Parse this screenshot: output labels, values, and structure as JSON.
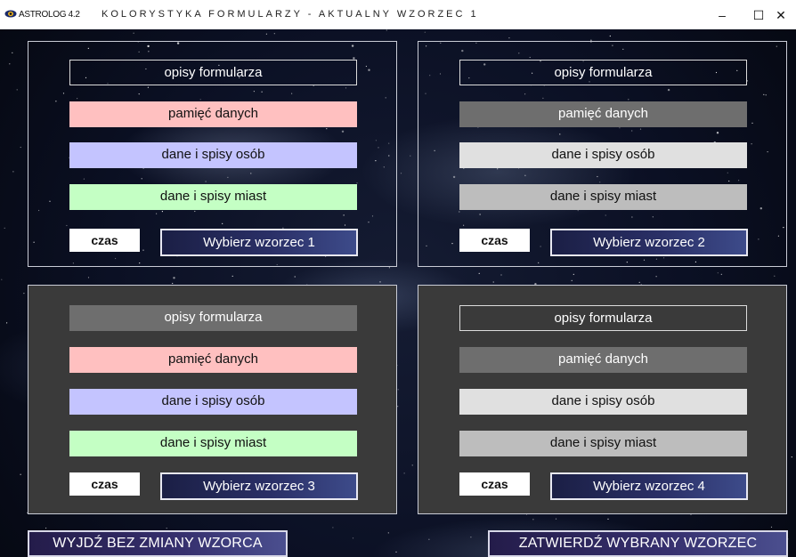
{
  "window": {
    "app_name": "ASTROLOG 4.2",
    "title": "KOLORYSTYKA FORMULARZY - AKTUALNY WZORZEC 1",
    "minimize": "–",
    "maximize": "☐",
    "close": "✕"
  },
  "panels": [
    {
      "bars": [
        {
          "label": "opisy formularza",
          "bg": "transparent",
          "fg": "#ffffff",
          "border": "#dcdcdc"
        },
        {
          "label": "pamięć danych",
          "bg": "#ffc0c0",
          "fg": "#111111",
          "border": "transparent"
        },
        {
          "label": "dane i spisy osób",
          "bg": "#c4c4ff",
          "fg": "#111111",
          "border": "transparent"
        },
        {
          "label": "dane i spisy miast",
          "bg": "#c4ffc4",
          "fg": "#111111",
          "border": "transparent"
        }
      ],
      "czas": "czas",
      "button": "Wybierz wzorzec 1"
    },
    {
      "bars": [
        {
          "label": "opisy formularza",
          "bg": "transparent",
          "fg": "#ffffff",
          "border": "#dcdcdc"
        },
        {
          "label": "pamięć danych",
          "bg": "#6e6e6e",
          "fg": "#ffffff",
          "border": "transparent"
        },
        {
          "label": "dane i spisy osób",
          "bg": "#e0e0e0",
          "fg": "#111111",
          "border": "transparent"
        },
        {
          "label": "dane i spisy miast",
          "bg": "#bdbdbd",
          "fg": "#111111",
          "border": "transparent"
        }
      ],
      "czas": "czas",
      "button": "Wybierz wzorzec 2"
    },
    {
      "bars": [
        {
          "label": "opisy formularza",
          "bg": "#6e6e6e",
          "fg": "#ffffff",
          "border": "transparent"
        },
        {
          "label": "pamięć danych",
          "bg": "#ffc0c0",
          "fg": "#111111",
          "border": "transparent"
        },
        {
          "label": "dane i spisy osób",
          "bg": "#c4c4ff",
          "fg": "#111111",
          "border": "transparent"
        },
        {
          "label": "dane i spisy miast",
          "bg": "#c4ffc4",
          "fg": "#111111",
          "border": "transparent"
        }
      ],
      "czas": "czas",
      "button": "Wybierz wzorzec 3"
    },
    {
      "bars": [
        {
          "label": "opisy formularza",
          "bg": "#3a3a3a",
          "fg": "#ffffff",
          "border": "#dcdcdc"
        },
        {
          "label": "pamięć danych",
          "bg": "#6e6e6e",
          "fg": "#ffffff",
          "border": "transparent"
        },
        {
          "label": "dane i spisy osób",
          "bg": "#e0e0e0",
          "fg": "#111111",
          "border": "transparent"
        },
        {
          "label": "dane i spisy miast",
          "bg": "#bdbdbd",
          "fg": "#111111",
          "border": "transparent"
        }
      ],
      "czas": "czas",
      "button": "Wybierz wzorzec 4"
    }
  ],
  "footer": {
    "exit_label": "WYJDŹ BEZ ZMIANY WZORCA",
    "confirm_label": "ZATWIERDŹ WYBRANY WZORZEC"
  }
}
